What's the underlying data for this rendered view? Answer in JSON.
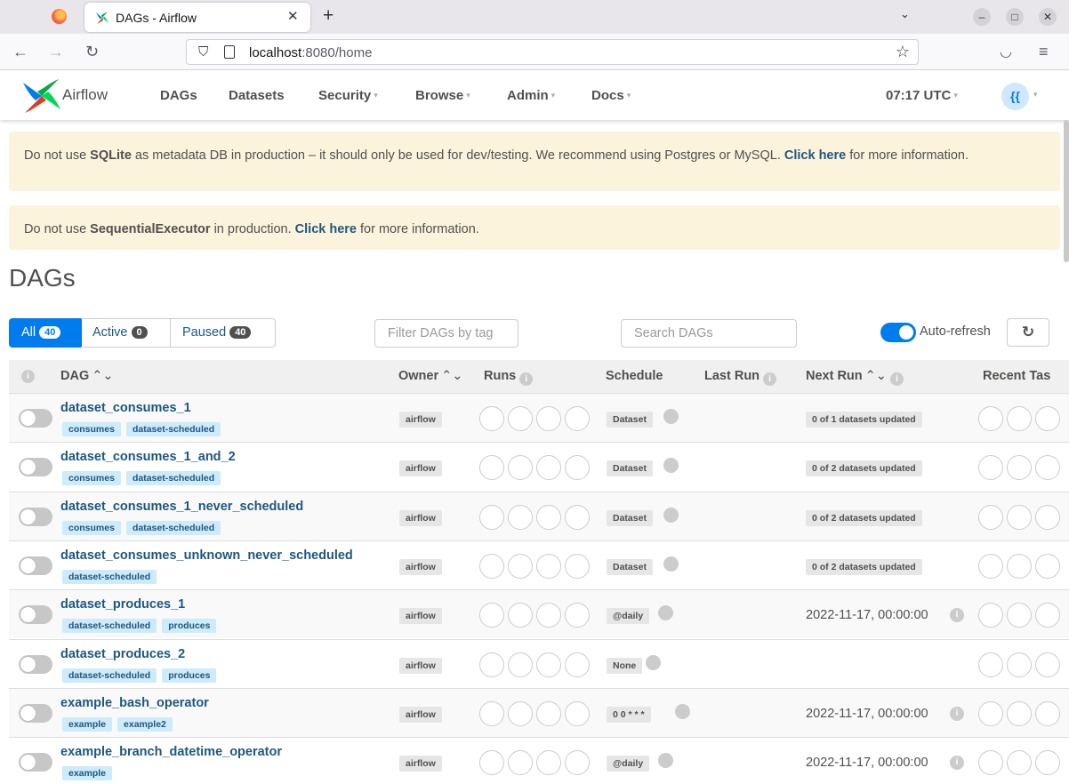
{
  "browser": {
    "tab_title": "DAGs - Airflow",
    "url_host": "localhost",
    "url_rest": ":8080/home"
  },
  "nav": {
    "brand": "Airflow",
    "menu": [
      "DAGs",
      "Datasets",
      "Security",
      "Browse",
      "Admin",
      "Docs"
    ],
    "time": "07:17 UTC",
    "user": "{{"
  },
  "alerts": {
    "sqlite": {
      "p1": "Do not use ",
      "b1": "SQLite",
      "p2": " as metadata DB in production – it should only be used for dev/testing. We recommend using Postgres or MySQL. ",
      "link": "Click here",
      "p3": " for more information."
    },
    "executor": {
      "p1": "Do not use ",
      "b1": "SequentialExecutor",
      "p2": " in production. ",
      "link": "Click here",
      "p3": " for more information."
    }
  },
  "page_title": "DAGs",
  "filters": {
    "all_label": "All",
    "all_count": "40",
    "active_label": "Active",
    "active_count": "0",
    "paused_label": "Paused",
    "paused_count": "40",
    "tag_placeholder": "Filter DAGs by tag",
    "search_placeholder": "Search DAGs",
    "autorefresh": "Auto-refresh"
  },
  "table": {
    "headers": {
      "dag": "DAG",
      "owner": "Owner",
      "runs": "Runs",
      "schedule": "Schedule",
      "last_run": "Last Run",
      "next_run": "Next Run",
      "recent_tasks": "Recent Tas"
    },
    "rows": [
      {
        "name": "dataset_consumes_1",
        "tags": [
          "consumes",
          "dataset-scheduled"
        ],
        "owner": "airflow",
        "schedule": "Dataset",
        "next_run": "0 of 1 datasets updated"
      },
      {
        "name": "dataset_consumes_1_and_2",
        "tags": [
          "consumes",
          "dataset-scheduled"
        ],
        "owner": "airflow",
        "schedule": "Dataset",
        "next_run": "0 of 2 datasets updated"
      },
      {
        "name": "dataset_consumes_1_never_scheduled",
        "tags": [
          "consumes",
          "dataset-scheduled"
        ],
        "owner": "airflow",
        "schedule": "Dataset",
        "next_run": "0 of 2 datasets updated"
      },
      {
        "name": "dataset_consumes_unknown_never_scheduled",
        "tags": [
          "dataset-scheduled"
        ],
        "owner": "airflow",
        "schedule": "Dataset",
        "next_run": "0 of 2 datasets updated"
      },
      {
        "name": "dataset_produces_1",
        "tags": [
          "dataset-scheduled",
          "produces"
        ],
        "owner": "airflow",
        "schedule": "@daily",
        "next_run_date": "2022-11-17, 00:00:00"
      },
      {
        "name": "dataset_produces_2",
        "tags": [
          "dataset-scheduled",
          "produces"
        ],
        "owner": "airflow",
        "schedule": "None"
      },
      {
        "name": "example_bash_operator",
        "tags": [
          "example",
          "example2"
        ],
        "owner": "airflow",
        "schedule": "0 0 * * *",
        "next_run_date": "2022-11-17, 00:00:00"
      },
      {
        "name": "example_branch_datetime_operator",
        "tags": [
          "example"
        ],
        "owner": "airflow",
        "schedule": "@daily",
        "next_run_date": "2022-11-17, 00:00:00"
      }
    ]
  }
}
